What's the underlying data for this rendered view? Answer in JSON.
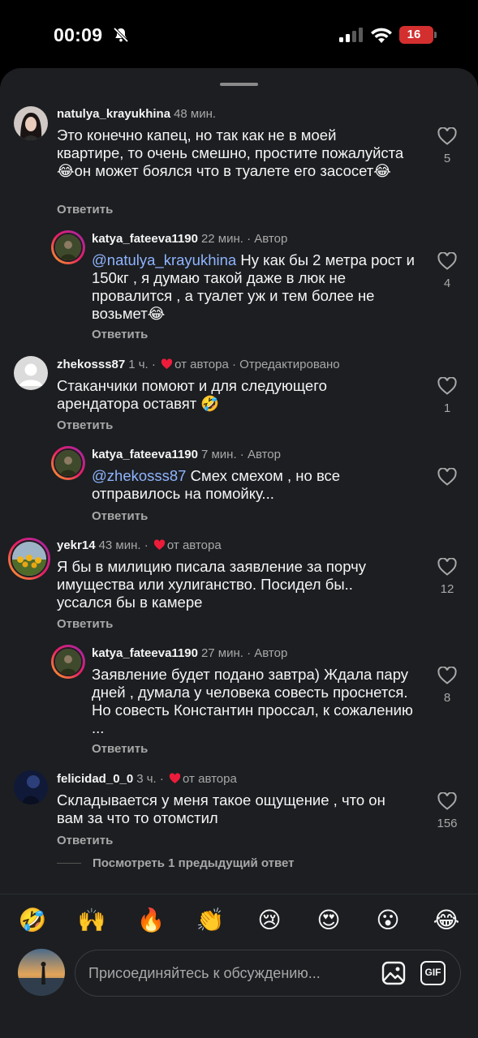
{
  "status_bar": {
    "time": "00:09",
    "battery": "16"
  },
  "comments": [
    {
      "username": "natulya_krayukhina",
      "time": "48 мин.",
      "tags": "",
      "mention": "",
      "text": "Это конечно капец, но так как не в моей квартире, то очень смешно, простите пожалуйста😂он может боялся что в туалете его засосет😂",
      "likes": "5",
      "reply_label": "Ответить",
      "avatar_icon": "woman-portrait"
    },
    {
      "username": "katya_fateeva1190",
      "time": "22 мин.",
      "tags": "· Автор",
      "mention": "@natulya_krayukhina",
      "text": " Ну как бы 2 метра рост и 150кг , я думаю такой даже в люк не провалится , а туалет уж и тем более не возьмет😂",
      "likes": "4",
      "reply_label": "Ответить",
      "avatar_icon": "person-greenery"
    },
    {
      "username": "zhekosss87",
      "time": "1 ч. ·",
      "liked_label": "от автора",
      "tags": "· Отредактировано",
      "mention": "",
      "text": "Стаканчики помоют и для следующего арендатора оставят 🤣",
      "likes": "1",
      "reply_label": "Ответить",
      "avatar_icon": "default-user"
    },
    {
      "username": "katya_fateeva1190",
      "time": "7 мин.",
      "tags": "· Автор",
      "mention": "@zhekosss87",
      "text": " Смех смехом , но все отправилось на помойку...",
      "likes": "",
      "reply_label": "Ответить",
      "avatar_icon": "person-greenery"
    },
    {
      "username": "yekr14",
      "time": "43 мин. ·",
      "liked_label": "от автора",
      "tags": "",
      "mention": "",
      "text": "Я бы в милицию писала заявление за порчу имущества или хулиганство. Посидел бы.. уссался бы в камере",
      "likes": "12",
      "reply_label": "Ответить",
      "avatar_icon": "sunflowers"
    },
    {
      "username": "katya_fateeva1190",
      "time": "27 мин.",
      "tags": "· Автор",
      "mention": "",
      "text": "Заявление будет подано завтра) Ждала пару дней , думала у человека совесть проснется. Но совесть Константин проссал, к сожалению ...",
      "likes": "8",
      "reply_label": "Ответить",
      "avatar_icon": "person-greenery"
    },
    {
      "username": "felicidad_0_0",
      "time": "3 ч. ·",
      "liked_label": "от автора",
      "tags": "",
      "mention": "",
      "text": "Складывается у меня такое ощущение , что он вам за что то отомстил",
      "likes": "156",
      "reply_label": "Ответить",
      "avatar_icon": "night-figure"
    }
  ],
  "see_more": "Посмотреть 1 предыдущий ответ",
  "emoji_bar": [
    "🤣",
    "🙌",
    "🔥",
    "👏",
    "😢",
    "😍",
    "😮",
    "😂"
  ],
  "composer": {
    "placeholder": "Присоединяйтесь к обсуждению...",
    "gif_label": "GIF"
  },
  "colors": {
    "sheet_bg": "#1c1e21",
    "heart_red": "#ed1c3a",
    "mention": "#8fb4ff",
    "muted": "#a8a8a8"
  }
}
